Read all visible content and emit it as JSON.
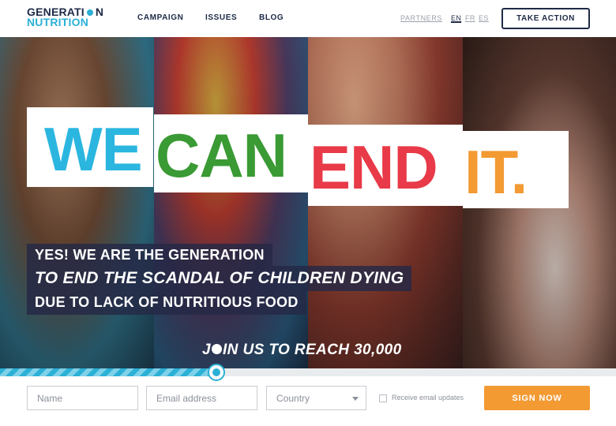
{
  "logo": {
    "line1_a": "GENERATI",
    "line1_b": "N",
    "line2": "NUTRITION"
  },
  "nav": {
    "items": [
      "CAMPAIGN",
      "ISSUES",
      "BLOG"
    ]
  },
  "header_right": {
    "partners": "PARTNERS",
    "languages": [
      "EN",
      "FR",
      "ES"
    ],
    "active_language": "EN",
    "cta": "TAKE ACTION"
  },
  "hero": {
    "words": [
      "WE",
      "CAN",
      "END",
      "IT."
    ],
    "word_colors": [
      "#2bb6e0",
      "#3a9a34",
      "#e83a48",
      "#f39a33"
    ],
    "tagline": [
      "YES! WE ARE THE GENERATION",
      "TO END THE SCANDAL OF CHILDREN DYING",
      "DUE TO LACK OF NUTRITIOUS FOOD"
    ],
    "join_a": "J",
    "join_b": "IN US TO REACH 30,000"
  },
  "progress": {
    "fraction": 0.34,
    "color": "#2bb0d6"
  },
  "form": {
    "name_placeholder": "Name",
    "email_placeholder": "Email address",
    "country_placeholder": "Country",
    "updates_label": "Receive email updates",
    "submit": "SIGN NOW"
  },
  "colors": {
    "navy": "#1e2a47",
    "accent": "#2bb0d6",
    "orange": "#f39a33"
  }
}
